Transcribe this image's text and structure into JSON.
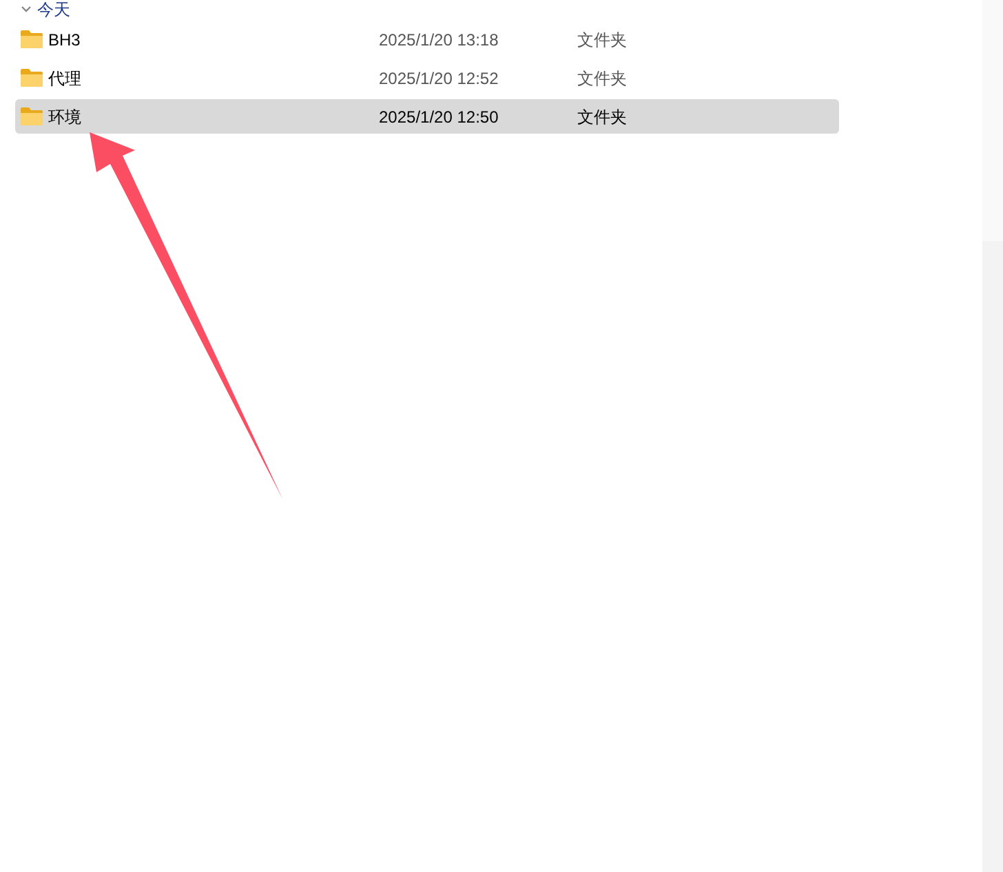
{
  "group": {
    "label": "今天",
    "expanded": true
  },
  "files": [
    {
      "name": "BH3",
      "modified": "2025/1/20 13:18",
      "type": "文件夹",
      "selected": false
    },
    {
      "name": "代理",
      "modified": "2025/1/20 12:52",
      "type": "文件夹",
      "selected": false
    },
    {
      "name": "环境",
      "modified": "2025/1/20 12:50",
      "type": "文件夹",
      "selected": true
    }
  ]
}
